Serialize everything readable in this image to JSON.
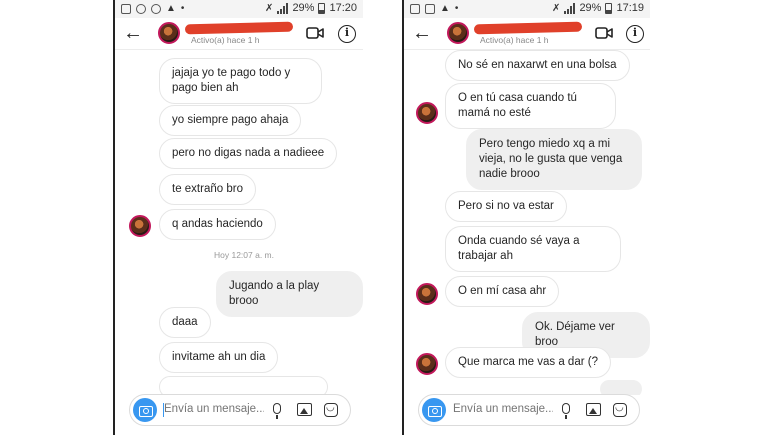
{
  "left": {
    "status": {
      "battery": "29%",
      "time": "17:20"
    },
    "header": {
      "active_text": "Activo(a) hace 1 h"
    },
    "messages": [
      "jajaja yo te pago todo y pago bien ah",
      "yo siempre pago ahaja",
      "pero no digas nada a nadieee",
      "te extraño bro",
      "q andas haciendo",
      "Jugando a la play brooo",
      "daaa",
      "invitame ah un dia"
    ],
    "timestamp": "Hoy 12:07 a. m.",
    "composer": {
      "placeholder": "Envía un mensaje..."
    }
  },
  "right": {
    "status": {
      "battery": "29%",
      "time": "17:19"
    },
    "header": {
      "active_text": "Activo(a) hace 1 h"
    },
    "messages": [
      "No sé en naxarwt en una bolsa",
      "O en tú casa cuando tú mamá no esté",
      "Pero tengo miedo xq a mi vieja, no le gusta que venga nadie brooo",
      "Pero si no va estar",
      "Onda cuando sé vaya a trabajar ah",
      "O en mí casa ahr",
      "Ok. Déjame ver broo",
      "Que marca me vas a dar (?"
    ],
    "composer": {
      "placeholder": "Envía un mensaje..."
    }
  },
  "icons": [
    "back-arrow-icon",
    "video-call-icon",
    "info-icon",
    "camera-icon",
    "microphone-icon",
    "gallery-icon",
    "sticker-icon"
  ],
  "colors": {
    "accent": "#3897f0",
    "redaction": "#e0402a",
    "outgoing_bubble": "#efefef"
  }
}
